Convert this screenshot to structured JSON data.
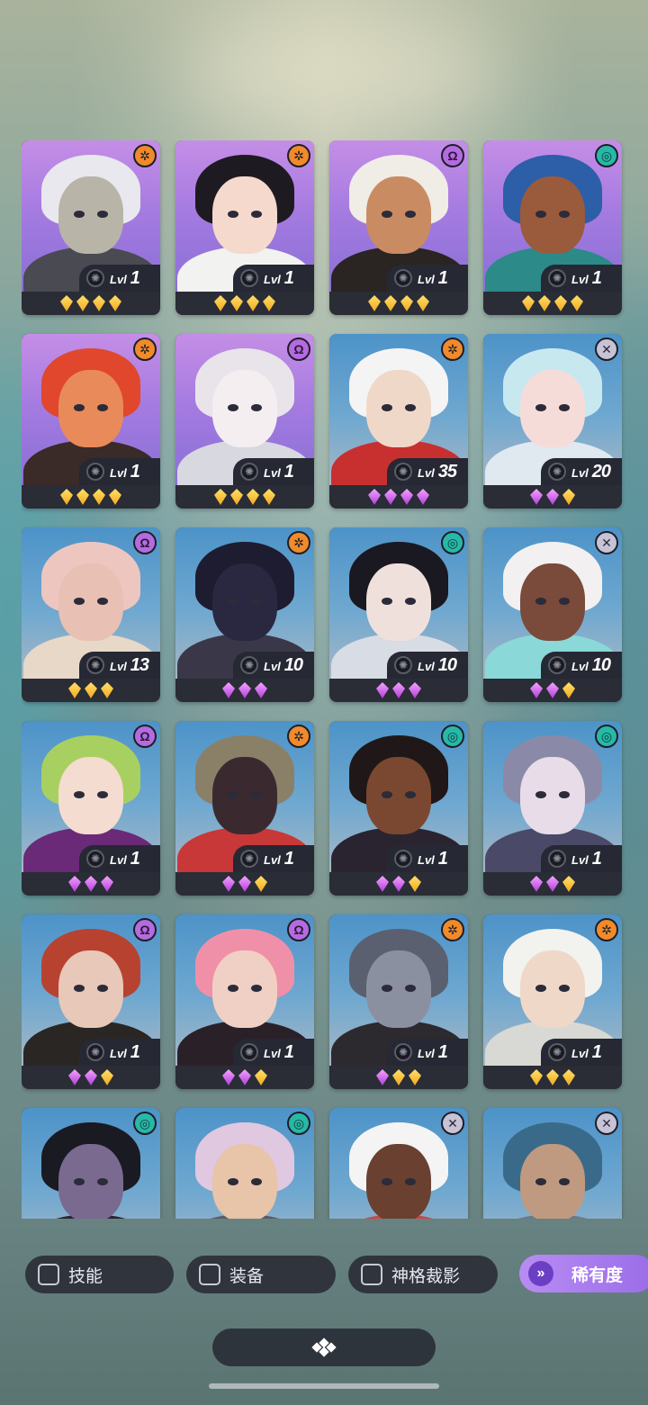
{
  "heroes": [
    {
      "portrait": "purple",
      "class": "orange",
      "class_icon": "gear-icon",
      "level": "1",
      "stars": [
        "gold",
        "gold",
        "gold",
        "gold"
      ],
      "skin": "#b9b4a8",
      "hair": "#e8e8ee",
      "body": "#4a4a52"
    },
    {
      "portrait": "purple",
      "class": "orange",
      "class_icon": "gear-icon",
      "level": "1",
      "stars": [
        "gold",
        "gold",
        "gold",
        "gold"
      ],
      "skin": "#f4d9cc",
      "hair": "#1e1a22",
      "body": "#f2f2f0"
    },
    {
      "portrait": "purple",
      "class": "purple",
      "class_icon": "omega-icon",
      "level": "1",
      "stars": [
        "gold",
        "gold",
        "gold",
        "gold"
      ],
      "skin": "#c98b62",
      "hair": "#f0ece6",
      "body": "#2a2422"
    },
    {
      "portrait": "purple",
      "class": "teal",
      "class_icon": "swirl-icon",
      "level": "1",
      "stars": [
        "gold",
        "gold",
        "gold",
        "gold"
      ],
      "skin": "#9a5a3c",
      "hair": "#2d5ea8",
      "body": "#2c8a88"
    },
    {
      "portrait": "purple",
      "class": "orange",
      "class_icon": "gear-icon",
      "level": "1",
      "stars": [
        "gold",
        "gold",
        "gold",
        "gold"
      ],
      "skin": "#e98a5a",
      "hair": "#e0472c",
      "body": "#3a2a28"
    },
    {
      "portrait": "purple",
      "class": "purple",
      "class_icon": "omega-icon",
      "level": "1",
      "stars": [
        "gold",
        "gold",
        "gold",
        "gold"
      ],
      "skin": "#f4eef0",
      "hair": "#e8e4ea",
      "body": "#d8d8e0"
    },
    {
      "portrait": "blue",
      "class": "orange",
      "class_icon": "gear-icon",
      "level": "35",
      "stars": [
        "violet",
        "violet",
        "violet",
        "violet"
      ],
      "skin": "#f0d8c8",
      "hair": "#f4f4f4",
      "body": "#c83030"
    },
    {
      "portrait": "blue",
      "class": "grey",
      "class_icon": "cross-icon",
      "level": "20",
      "stars": [
        "violet",
        "violet",
        "gold"
      ],
      "skin": "#f6dcd8",
      "hair": "#c8e8f0",
      "body": "#e0e8f0"
    },
    {
      "portrait": "blue",
      "class": "purple",
      "class_icon": "omega-icon",
      "level": "13",
      "stars": [
        "gold",
        "gold",
        "gold"
      ],
      "skin": "#e8c0b4",
      "hair": "#eec6c0",
      "body": "#e8d8c8"
    },
    {
      "portrait": "blue",
      "class": "orange",
      "class_icon": "gear-icon",
      "level": "10",
      "stars": [
        "violet",
        "violet",
        "violet"
      ],
      "skin": "#2a2840",
      "hair": "#1e1c30",
      "body": "#3a3848"
    },
    {
      "portrait": "blue",
      "class": "teal",
      "class_icon": "swirl-icon",
      "level": "10",
      "stars": [
        "violet",
        "violet",
        "violet"
      ],
      "skin": "#f0e0dc",
      "hair": "#1a1820",
      "body": "#d8dce4"
    },
    {
      "portrait": "blue",
      "class": "grey",
      "class_icon": "cross-icon",
      "level": "10",
      "stars": [
        "violet",
        "violet",
        "gold"
      ],
      "skin": "#7a4a3a",
      "hair": "#f2f0f0",
      "body": "#8ad8d8"
    },
    {
      "portrait": "blue",
      "class": "purple",
      "class_icon": "omega-icon",
      "level": "1",
      "stars": [
        "violet",
        "violet",
        "violet"
      ],
      "skin": "#f4dcd0",
      "hair": "#a8d060",
      "body": "#6a2a78"
    },
    {
      "portrait": "blue",
      "class": "orange",
      "class_icon": "gear-icon",
      "level": "1",
      "stars": [
        "violet",
        "violet",
        "gold"
      ],
      "skin": "#3a2a30",
      "hair": "#8a8068",
      "body": "#c83838"
    },
    {
      "portrait": "blue",
      "class": "teal",
      "class_icon": "swirl-icon",
      "level": "1",
      "stars": [
        "violet",
        "violet",
        "gold"
      ],
      "skin": "#7a4830",
      "hair": "#201818",
      "body": "#2a2430"
    },
    {
      "portrait": "blue",
      "class": "teal",
      "class_icon": "swirl-icon",
      "level": "1",
      "stars": [
        "violet",
        "violet",
        "gold"
      ],
      "skin": "#e8dce8",
      "hair": "#8a8aa8",
      "body": "#4a4a68"
    },
    {
      "portrait": "blue",
      "class": "purple",
      "class_icon": "omega-icon",
      "level": "1",
      "stars": [
        "violet",
        "violet",
        "gold"
      ],
      "skin": "#e8c8b8",
      "hair": "#b84230",
      "body": "#2a2624"
    },
    {
      "portrait": "blue",
      "class": "purple",
      "class_icon": "omega-icon",
      "level": "1",
      "stars": [
        "violet",
        "violet",
        "gold"
      ],
      "skin": "#f0d0c4",
      "hair": "#f090a8",
      "body": "#2a2028"
    },
    {
      "portrait": "blue",
      "class": "orange",
      "class_icon": "gear-icon",
      "level": "1",
      "stars": [
        "violet",
        "gold",
        "gold"
      ],
      "skin": "#8a90a0",
      "hair": "#5a6070",
      "body": "#2c2a2e"
    },
    {
      "portrait": "blue",
      "class": "orange",
      "class_icon": "gear-icon",
      "level": "1",
      "stars": [
        "gold",
        "gold",
        "gold"
      ],
      "skin": "#f0d8c8",
      "hair": "#f2f2ee",
      "body": "#d8d8d4"
    },
    {
      "portrait": "blue",
      "class": "teal",
      "class_icon": "swirl-icon",
      "level": "",
      "stars": [],
      "skin": "#7a6a90",
      "hair": "#1a1a22",
      "body": "#2a2430"
    },
    {
      "portrait": "blue",
      "class": "teal",
      "class_icon": "swirl-icon",
      "level": "",
      "stars": [],
      "skin": "#e8c4a8",
      "hair": "#e0c8e0",
      "body": "#5a5a68"
    },
    {
      "portrait": "blue",
      "class": "grey",
      "class_icon": "cross-icon",
      "level": "",
      "stars": [],
      "skin": "#6a4030",
      "hair": "#f4f4f4",
      "body": "#c84848"
    },
    {
      "portrait": "blue",
      "class": "grey",
      "class_icon": "cross-icon",
      "level": "",
      "stars": [],
      "skin": "#c09a80",
      "hair": "#3a6a8a",
      "body": "#6a7a8a"
    }
  ],
  "level_label": "Lvl",
  "filters": [
    {
      "label": "技能"
    },
    {
      "label": "装备"
    },
    {
      "label": "神格裁影"
    }
  ],
  "sort_button": {
    "label": "稀有度",
    "icon": "chevron-double-down-icon"
  },
  "collapse_button": {
    "icon": "diamond-cluster-icon"
  },
  "colors": {
    "accent": "#9a6de8",
    "gold": "#f2a91e",
    "violet": "#b03fd8"
  }
}
